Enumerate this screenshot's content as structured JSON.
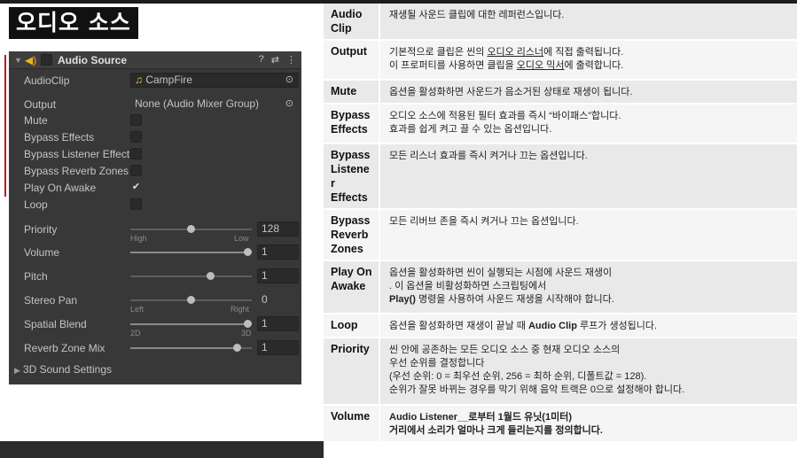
{
  "page_title": "오디오 소스",
  "inspector": {
    "component_name": "Audio Source",
    "header_icons": [
      "help-icon",
      "preset-icon",
      "more-icon"
    ],
    "audio_clip": {
      "label": "AudioClip",
      "value": "CampFire"
    },
    "output": {
      "label": "Output",
      "value": "None (Audio Mixer Group)"
    },
    "mute": {
      "label": "Mute",
      "checked": false
    },
    "bypass_effects": {
      "label": "Bypass Effects",
      "checked": false
    },
    "bypass_listener": {
      "label": "Bypass Listener Effect",
      "checked": false
    },
    "bypass_reverb": {
      "label": "Bypass Reverb Zones",
      "checked": false
    },
    "play_on_awake": {
      "label": "Play On Awake",
      "checked": true,
      "mark": "✔"
    },
    "loop": {
      "label": "Loop",
      "checked": false
    },
    "priority": {
      "label": "Priority",
      "value": "128",
      "min_label": "High",
      "max_label": "Low",
      "level": 0.5
    },
    "volume": {
      "label": "Volume",
      "value": "1",
      "level": 1.0
    },
    "pitch": {
      "label": "Pitch",
      "value": "1",
      "level": 0.67
    },
    "stereo_pan": {
      "label": "Stereo Pan",
      "value": "0",
      "min_label": "Left",
      "max_label": "Right",
      "level": 0.5
    },
    "spatial_blend": {
      "label": "Spatial Blend",
      "value": "1",
      "min_label": "2D",
      "max_label": "3D",
      "level": 1.0
    },
    "reverb_zone_mix": {
      "label": "Reverb Zone Mix",
      "value": "1",
      "level": 0.91
    },
    "sound_settings": {
      "label": "3D Sound Settings"
    }
  },
  "table": {
    "audio_clip": {
      "name": "Audio Clip",
      "desc": "재생될 사운드 클립에 대한 레퍼런스입니다."
    },
    "output": {
      "name": "Output",
      "line1": "기본적으로 클립은 씬의 ",
      "line1_u": "오디오 리스너",
      "line1_end": "에 직접 출력됩니다.",
      "line2": "이 프로퍼티를 사용하면 클립을 ",
      "line2_u": "오디오 믹서",
      "line2_end": "에 출력합니다."
    },
    "mute": {
      "name": "Mute",
      "desc": "옵션을 활성화하면 사운드가 음소거된 상태로 재생이 됩니다."
    },
    "bypass_effects": {
      "name": "Bypass Effects",
      "line1": "오디오 소스에 적용된 필터 효과를 즉시 “바이패스”합니다.",
      "line2": " 효과를 쉽게 켜고 끌 수 있는 옵션입니다."
    },
    "bypass_listener": {
      "name": "Bypass Listene r Effects",
      "desc": "모든 리스너 효과를 즉시 켜거나 끄는 옵션입니다."
    },
    "bypass_reverb": {
      "name": "Bypass Reverb Zones",
      "desc": "모든 리버브 존을 즉시 켜거나 끄는 옵션입니다."
    },
    "play_on_awake": {
      "name": "Play On Awake",
      "line1": "옵션을 활성화하면 씬이 실행되는 시점에 사운드 재생이",
      "line2": ". 이 옵션을 비활성화하면 스크립팅에서",
      "line3_b": "Play()",
      "line3": " 명령을 사용하여 사운드 재생을 시작해야 합니다."
    },
    "loop": {
      "name": "Loop",
      "pre": "옵션을 활성화하면 재생이 끝날 때 ",
      "b": "Audio Clip",
      "post": " 루프가 생성됩니다."
    },
    "priority": {
      "name": "Priority",
      "line1": "씬 안에 공존하는 모든 오디오 소스 중 현재 오디오 소스의",
      "line2": "우선 순위를 결정합니다",
      "line3": "(우선 순위: 0 = 최우선 순위, 256 = 최하 순위, 디폴트값 = 128).",
      "line4": "순위가 잘못 바뀌는 경우를 막기 위해 음악 트랙은 0으로 설정해야 합니다."
    },
    "volume": {
      "name": "Volume",
      "line1": "Audio Listener__로부터 1월드 유닛(1미터)",
      "line2": "거리에서 소리가 얼마나 크게 들리는지를 정의합니다."
    }
  }
}
